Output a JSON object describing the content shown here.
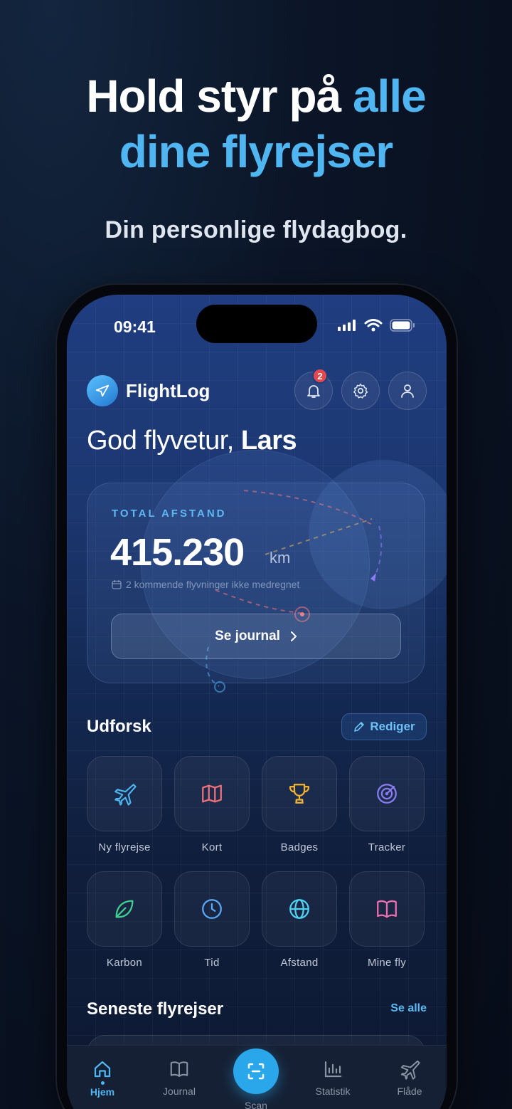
{
  "hero": {
    "title_line1_white": "Hold styr på ",
    "title_line1_accent": "alle",
    "title_line2_accent": "dine flyrejser",
    "subtitle": "Din personlige flydagbog."
  },
  "status_bar": {
    "time": "09:41"
  },
  "header": {
    "app_name": "FlightLog",
    "notification_count": "2",
    "icons": [
      "plane-icon",
      "bell-icon",
      "gear-icon",
      "user-icon"
    ]
  },
  "greeting": {
    "prefix": "God flyvetur, ",
    "name": "Lars"
  },
  "distance_card": {
    "label": "TOTAL AFSTAND",
    "value": "415.230",
    "unit": "km",
    "note": "2 kommende flyvninger ikke medregnet",
    "button_label": "Se journal"
  },
  "explore": {
    "title": "Udforsk",
    "edit_label": "Rediger",
    "tiles": [
      {
        "label": "Ny flyrejse",
        "icon": "plane-icon",
        "color": "#4fb6f2"
      },
      {
        "label": "Kort",
        "icon": "map-icon",
        "color": "#f0707a"
      },
      {
        "label": "Badges",
        "icon": "trophy-icon",
        "color": "#f2b233"
      },
      {
        "label": "Tracker",
        "icon": "radar-icon",
        "color": "#8a7cf0"
      },
      {
        "label": "Karbon",
        "icon": "leaf-icon",
        "color": "#3fcf8e"
      },
      {
        "label": "Tid",
        "icon": "clock-icon",
        "color": "#5aa8f5"
      },
      {
        "label": "Afstand",
        "icon": "globe-icon",
        "color": "#4fd0f0"
      },
      {
        "label": "Mine fly",
        "icon": "book-icon",
        "color": "#ec6fb0"
      }
    ]
  },
  "recent": {
    "title": "Seneste flyrejser",
    "see_all_label": "Se alle"
  },
  "tabbar": {
    "tabs": [
      {
        "label": "Hjem",
        "icon": "home-icon",
        "active": true
      },
      {
        "label": "Journal",
        "icon": "book-icon",
        "active": false
      },
      {
        "label": "Scan",
        "icon": "scan-icon",
        "active": false
      },
      {
        "label": "Statistik",
        "icon": "bar-chart-icon",
        "active": false
      },
      {
        "label": "Flåde",
        "icon": "plane-icon",
        "active": false
      }
    ]
  },
  "colors": {
    "accent": "#4fb6f2",
    "badge": "#e5484d",
    "scan_button": "#2aa7ea"
  }
}
